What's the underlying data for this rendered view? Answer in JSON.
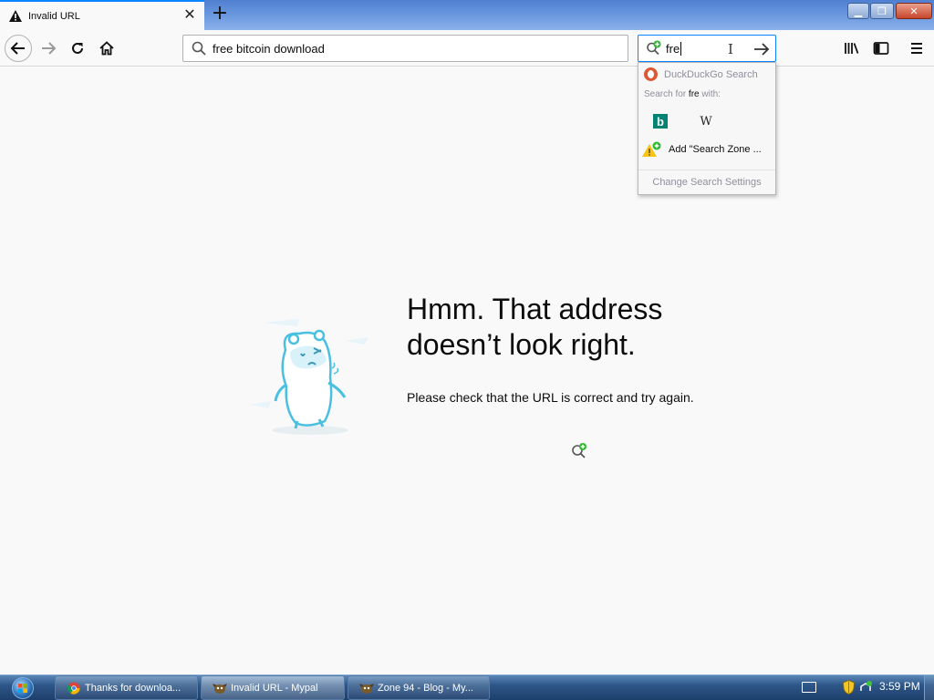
{
  "window": {
    "tab_title": "Invalid URL",
    "new_tab_label": "+",
    "close_tab_label": "✕",
    "min_label": "▁",
    "max_label": "❐",
    "close_label": "✕"
  },
  "navbar": {
    "url_text": "free bitcoin download",
    "search_text": "fre"
  },
  "search_popup": {
    "engine_name": "DuckDuckGo Search",
    "search_for_prefix": "Search for ",
    "search_for_term": "fre",
    "search_for_suffix": " with:",
    "engines": [
      {
        "name": "bing-icon",
        "glyph": "b"
      },
      {
        "name": "wikipedia-icon",
        "glyph": "W"
      }
    ],
    "add_engine_label": "Add \"Search Zone ...",
    "settings_label": "Change Search Settings"
  },
  "error_page": {
    "title": "Hmm. That address doesn’t look right.",
    "description": "Please check that the URL is correct and try again."
  },
  "taskbar": {
    "tasks": [
      {
        "label": "Thanks for downloa...",
        "icon": "chrome-icon"
      },
      {
        "label": "Invalid URL - Mypal",
        "icon": "mypal-icon"
      },
      {
        "label": "Zone 94 - Blog - My...",
        "icon": "mypal-icon"
      }
    ],
    "clock": "3:59 PM"
  },
  "colors": {
    "accent": "#0a84ff",
    "ddg": "#de5833",
    "bing": "#008373",
    "taskbar": "#2d5688"
  }
}
